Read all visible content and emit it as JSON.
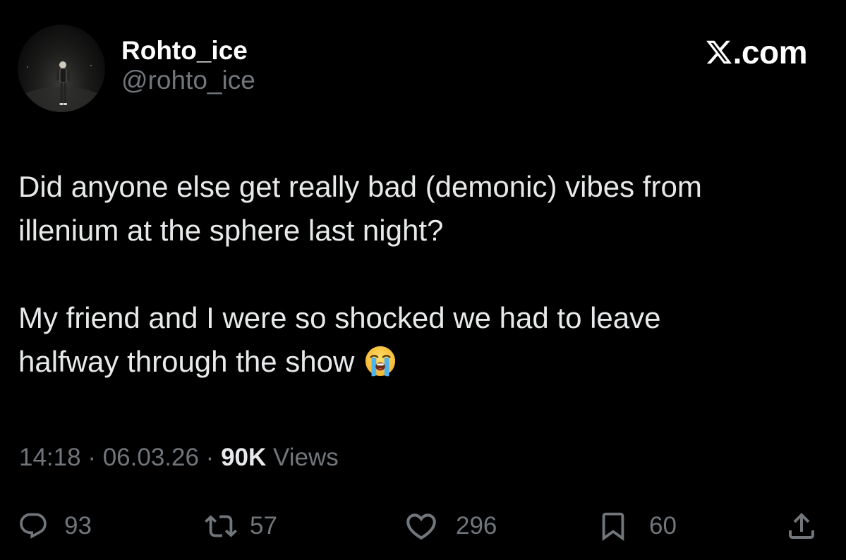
{
  "author": {
    "display_name": "Rohto_ice",
    "handle": "@rohto_ice",
    "avatar_icon": "person-standing-at-night-photo"
  },
  "brand": {
    "text": ".com",
    "logo_icon": "x-logo-icon"
  },
  "tweet": {
    "paragraphs": [
      {
        "lines": [
          "Did anyone else get really bad (demonic) vibes from",
          "illenium at the sphere last night?"
        ]
      },
      {
        "lines": [
          "My friend and I were so shocked we had to leave",
          "halfway through the show"
        ],
        "trailing_emoji": "loudly-crying-face-emoji"
      }
    ]
  },
  "meta": {
    "time": "14:18",
    "separator": " · ",
    "date": "06.03.26",
    "views_count": "90K",
    "views_label": " Views"
  },
  "actions": {
    "reply": {
      "icon": "reply-icon",
      "count": "93"
    },
    "repost": {
      "icon": "repost-icon",
      "count": "57"
    },
    "like": {
      "icon": "heart-icon",
      "count": "296"
    },
    "bookmark": {
      "icon": "bookmark-icon",
      "count": "60"
    },
    "share": {
      "icon": "share-icon"
    }
  },
  "colors": {
    "background": "#000000",
    "primary_text": "#e7e9ea",
    "secondary_text": "#71767b"
  }
}
